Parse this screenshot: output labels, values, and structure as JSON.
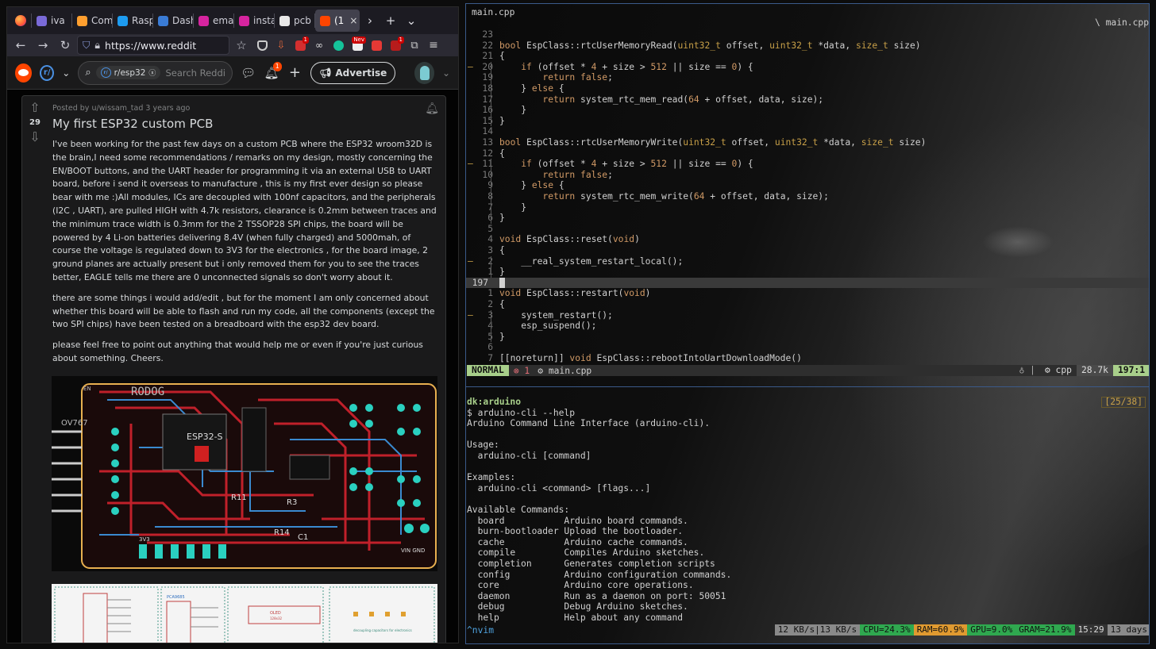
{
  "browser": {
    "tabs": [
      {
        "label": "iva",
        "color": "#7a6ad8",
        "active": false
      },
      {
        "label": "Com",
        "color": "#ff9f2f",
        "active": false
      },
      {
        "label": "Rasp",
        "color": "#1d9bf0",
        "active": false
      },
      {
        "label": "Dash",
        "color": "#3a7bd5",
        "active": false
      },
      {
        "label": "ema",
        "color": "#d6249f",
        "active": false
      },
      {
        "label": "insta",
        "color": "#d6249f",
        "active": false
      },
      {
        "label": "pcb",
        "color": "#e8e8e8",
        "active": false
      },
      {
        "label": "(1",
        "color": "#ff4500",
        "active": true
      }
    ],
    "url": "https://www.reddit",
    "extension_badges": {
      "abp": "1",
      "new": "Nev",
      "ext7": "1"
    }
  },
  "reddit": {
    "search_chip": "r/esp32",
    "search_placeholder": "Search Reddi",
    "notif_count": "1",
    "advertise_label": "Advertise",
    "post": {
      "posted_by": "Posted by u/wissam_tad 3 years ago",
      "votes": "29",
      "title": "My first ESP32 custom PCB",
      "paragraphs": [
        "I've been working for the past few days on a custom PCB where the ESP32 wroom32D is the brain,I need some recommendations / remarks on my design, mostly concerning the EN/BOOT buttons, and the UART header for programming it via an external USB to UART board, before i send it overseas to manufacture , this is my first ever design so please bear with me :)All modules, ICs are decoupled with 100nf capacitors, and the peripherals (I2C , UART), are pulled HIGH with 4.7k resistors, clearance is 0.2mm between traces and the minimum trace width is 0.3mm for the 2 TSSOP28 SPI chips, the board will be powered by 4 Li-on batteries delivering 8.4V (when fully charged) and 5000mah, of course the voltage is regulated down to 3V3 for the electronics , for the board image, 2 ground planes are actually present but i only removed them for you to see the traces better, EAGLE tells me there are 0 unconnected signals so don't worry about it.",
        "there are some things i would add/edit , but for the moment I am only concerned about whether this board will be able to flash and run my code, all the components (except the two SPI chips) have been tested on a breadboard with the esp32 dev board.",
        "please feel free to point out anything that would help me or even if you're just curious about something. Cheers."
      ],
      "pcb_labels": {
        "name": "RODOG",
        "module": "ESP32-S",
        "r14": "R14",
        "c1": "C1",
        "r11": "R11",
        "r3": "R3",
        "vin": "VIN GND",
        "v3": "3V3",
        "ov": "OV767",
        "en": "EN"
      },
      "schem_labels": {
        "a": "PCA9685",
        "b": "OLED",
        "c": "128x32",
        "d": "decoupling capacitors for electronics"
      }
    }
  },
  "editor": {
    "filename": "main.cpp",
    "title_right": "\\ main.cpp",
    "lines": [
      {
        "n": "23",
        "text": ""
      },
      {
        "n": "22",
        "text": "bool EspClass::rtcUserMemoryRead(uint32_t offset, uint32_t *data, size_t size)"
      },
      {
        "n": "21",
        "text": "{"
      },
      {
        "n": "20",
        "text": "    if (offset * 4 + size > 512 || size == 0) {",
        "sign": "–"
      },
      {
        "n": "19",
        "text": "        return false;"
      },
      {
        "n": "18",
        "text": "    } else {"
      },
      {
        "n": "17",
        "text": "        return system_rtc_mem_read(64 + offset, data, size);"
      },
      {
        "n": "16",
        "text": "    }"
      },
      {
        "n": "15",
        "text": "}"
      },
      {
        "n": "14",
        "text": ""
      },
      {
        "n": "13",
        "text": "bool EspClass::rtcUserMemoryWrite(uint32_t offset, uint32_t *data, size_t size)"
      },
      {
        "n": "12",
        "text": "{"
      },
      {
        "n": "11",
        "text": "    if (offset * 4 + size > 512 || size == 0) {",
        "sign": "–"
      },
      {
        "n": "10",
        "text": "        return false;"
      },
      {
        "n": "9",
        "text": "    } else {"
      },
      {
        "n": "8",
        "text": "        return system_rtc_mem_write(64 + offset, data, size);"
      },
      {
        "n": "7",
        "text": "    }"
      },
      {
        "n": "6",
        "text": "}"
      },
      {
        "n": "5",
        "text": ""
      },
      {
        "n": "4",
        "text": "void EspClass::reset(void)"
      },
      {
        "n": "3",
        "text": "{"
      },
      {
        "n": "2",
        "text": "    __real_system_restart_local();",
        "sign": "–"
      },
      {
        "n": "1",
        "text": "}"
      },
      {
        "n": "197",
        "text": "",
        "current": true
      },
      {
        "n": "1",
        "text": "void EspClass::restart(void)"
      },
      {
        "n": "2",
        "text": "{"
      },
      {
        "n": "3",
        "text": "    system_restart();",
        "sign": "–"
      },
      {
        "n": "4",
        "text": "    esp_suspend();"
      },
      {
        "n": "5",
        "text": "}"
      },
      {
        "n": "6",
        "text": ""
      },
      {
        "n": "7",
        "text": "[[noreturn]] void EspClass::rebootIntoUartDownloadMode()"
      }
    ],
    "status": {
      "mode": "NORMAL",
      "errors": "⊗ 1",
      "file": "⚙ main.cpp",
      "filetype": "⚙ cpp",
      "size": "28.7k",
      "position": "197:1",
      "icon": "♁ |"
    }
  },
  "shell": {
    "host": "dk:arduino",
    "count": "[25/38]",
    "lines": [
      "$ arduino-cli --help",
      "Arduino Command Line Interface (arduino-cli).",
      "",
      "Usage:",
      "  arduino-cli [command]",
      "",
      "Examples:",
      "  arduino-cli <command> [flags...]",
      "",
      "Available Commands:",
      "  board           Arduino board commands.",
      "  burn-bootloader Upload the bootloader.",
      "  cache           Arduino cache commands.",
      "  compile         Compiles Arduino sketches.",
      "  completion      Generates completion scripts",
      "  config          Arduino configuration commands.",
      "  core            Arduino core operations.",
      "  daemon          Run as a daemon on port: 50051",
      "  debug           Debug Arduino sketches.",
      "  help            Help about any command"
    ]
  },
  "tmux": {
    "window": "^nvim",
    "net": "12 KB/s|13 KB/s",
    "cpu": "CPU=24.3%",
    "ram": "RAM=60.9%",
    "gpu": "GPU=9.0%",
    "gram": "GRAM=21.9%",
    "time": "15:29",
    "uptime": "13 days"
  }
}
